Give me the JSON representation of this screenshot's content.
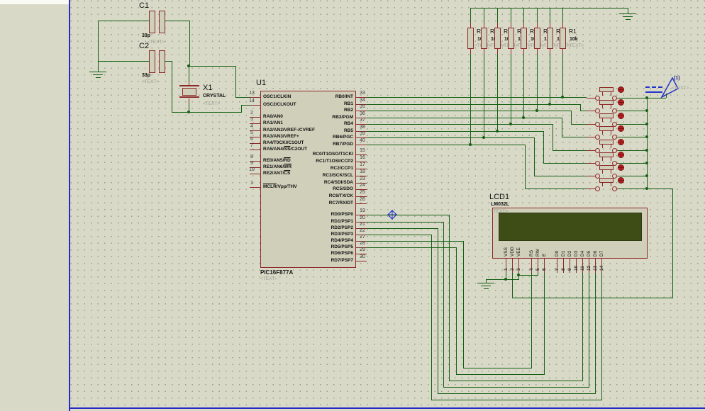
{
  "colors": {
    "background": "#d9d9c7",
    "wire_green": "#156015",
    "component_outline": "#8e2a2a",
    "component_fill": "#cfcfba",
    "lcd_screen_olive": "#3e4c16",
    "sheet_border_blue": "#2929c8",
    "marker_blue": "#2233cc",
    "actuator_red": "#c22222",
    "placeholder_gray": "#9f9f95"
  },
  "components": {
    "c1": {
      "ref": "C1",
      "value": "33p",
      "text": "<TEXT>"
    },
    "c2": {
      "ref": "C2",
      "value": "33p",
      "text": "<TEXT>"
    },
    "x1": {
      "ref": "X1",
      "value": "CRYSTAL",
      "text": "<TEXT>"
    },
    "u1": {
      "ref": "U1",
      "value": "PIC16F877A",
      "text": "<TEXT>",
      "left_pins": [
        {
          "num": "13",
          "pre": "OSC1/CLKIN",
          "ov": "",
          "post": ""
        },
        {
          "num": "14",
          "pre": "OSC2/CLKOUT",
          "ov": "",
          "post": ""
        },
        {
          "num": "2",
          "pre": "RA0/AN0",
          "ov": "",
          "post": ""
        },
        {
          "num": "3",
          "pre": "RA1/AN1",
          "ov": "",
          "post": ""
        },
        {
          "num": "4",
          "pre": "RA2/AN2/VREF-/CVREF",
          "ov": "",
          "post": ""
        },
        {
          "num": "5",
          "pre": "RA3/AN3/VREF+",
          "ov": "",
          "post": ""
        },
        {
          "num": "6",
          "pre": "RA4/T0CKI/C1OUT",
          "ov": "",
          "post": ""
        },
        {
          "num": "7",
          "pre": "RA5/AN4/",
          "ov": "SS",
          "post": "/C2OUT"
        },
        {
          "num": "8",
          "pre": "RE0/AN5/",
          "ov": "RD",
          "post": ""
        },
        {
          "num": "9",
          "pre": "RE1/AN6/",
          "ov": "WR",
          "post": ""
        },
        {
          "num": "10",
          "pre": "RE2/AN7/",
          "ov": "CS",
          "post": ""
        },
        {
          "num": "1",
          "pre": "",
          "ov": "MCLR",
          "post": "/Vpp/THV"
        }
      ],
      "right_pins_b": [
        {
          "num": "33",
          "label": "RB0/INT"
        },
        {
          "num": "34",
          "label": "RB1"
        },
        {
          "num": "35",
          "label": "RB2"
        },
        {
          "num": "36",
          "label": "RB3/PGM"
        },
        {
          "num": "37",
          "label": "RB4"
        },
        {
          "num": "38",
          "label": "RB5"
        },
        {
          "num": "39",
          "label": "RB6/PGC"
        },
        {
          "num": "40",
          "label": "RB7/PGD"
        }
      ],
      "right_pins_c": [
        {
          "num": "15",
          "label": "RC0/T1OSO/T1CKI"
        },
        {
          "num": "16",
          "label": "RC1/T1OSI/CCP2"
        },
        {
          "num": "17",
          "label": "RC2/CCP1"
        },
        {
          "num": "18",
          "label": "RC3/SCK/SCL"
        },
        {
          "num": "23",
          "label": "RC4/SDI/SDA"
        },
        {
          "num": "24",
          "label": "RC5/SDO"
        },
        {
          "num": "25",
          "label": "RC6/TX/CK"
        },
        {
          "num": "26",
          "label": "RC7/RX/DT"
        }
      ],
      "right_pins_d": [
        {
          "num": "19",
          "label": "RD0/PSP0"
        },
        {
          "num": "20",
          "label": "RD1/PSP1"
        },
        {
          "num": "21",
          "label": "RD2/PSP2"
        },
        {
          "num": "22",
          "label": "RD3/PSP3"
        },
        {
          "num": "27",
          "label": "RD4/PSP4"
        },
        {
          "num": "28",
          "label": "RD5/PSP5"
        },
        {
          "num": "29",
          "label": "RD6/PSP6"
        },
        {
          "num": "30",
          "label": "RD7/PSP7"
        }
      ]
    },
    "resistors": [
      {
        "ref": "R8",
        "value": "10k",
        "text": "<TEXT>"
      },
      {
        "ref": "R7",
        "value": "10k",
        "text": "<TEXT>"
      },
      {
        "ref": "R6",
        "value": "10k",
        "text": "<TEXT>"
      },
      {
        "ref": "R5",
        "value": "10k",
        "text": "<TEXT>"
      },
      {
        "ref": "R4",
        "value": "10k",
        "text": "<TEXT>"
      },
      {
        "ref": "R3",
        "value": "10k",
        "text": "<TEXT>"
      },
      {
        "ref": "R2",
        "value": "10k",
        "text": "<TEXT>"
      },
      {
        "ref": "R1",
        "value": "10k",
        "text": "<TEXT>"
      }
    ],
    "lcd1": {
      "ref": "LCD1",
      "value": "LM032L",
      "text": "<TEXT>",
      "pins": [
        {
          "num": "1",
          "name": "VSS"
        },
        {
          "num": "2",
          "name": "VDD"
        },
        {
          "num": "3",
          "name": "VEE"
        },
        {
          "num": "4",
          "name": "RS"
        },
        {
          "num": "5",
          "name": "RW"
        },
        {
          "num": "6",
          "name": "E"
        },
        {
          "num": "7",
          "name": "D0"
        },
        {
          "num": "8",
          "name": "D1"
        },
        {
          "num": "9",
          "name": "D2"
        },
        {
          "num": "10",
          "name": "D3"
        },
        {
          "num": "11",
          "name": "D4"
        },
        {
          "num": "12",
          "name": "D5"
        },
        {
          "num": "13",
          "name": "D6"
        },
        {
          "num": "14",
          "name": "D7"
        }
      ]
    },
    "logic_state": {
      "state_label": "(1)",
      "text": "<TEXT>"
    }
  }
}
